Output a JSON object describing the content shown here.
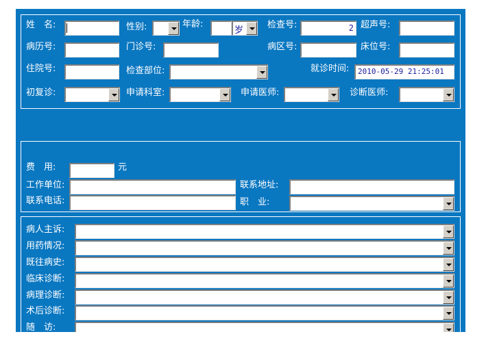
{
  "top": {
    "name_label": "姓　名:",
    "gender_label": "性别:",
    "age_label": "年龄:",
    "age_unit": "岁",
    "exam_no_label": "检查号:",
    "exam_no_value": "2",
    "ultrasound_no_label": "超声号:",
    "record_no_label": "病历号:",
    "clinic_no_label": "门诊号:",
    "ward_label": "病区号:",
    "bed_label": "床位号:",
    "inpatient_no_label": "住院号:",
    "exam_site_label": "检查部位:",
    "visit_time_label": "就诊时间:",
    "visit_time_value": "2010-05-29 21:25:01",
    "first_visit_label": "初复诊:",
    "dept_label": "申请科室:",
    "req_doctor_label": "申请医师:",
    "diag_doctor_label": "诊断医师:"
  },
  "middle": {
    "fee_label": "费　用:",
    "fee_unit": "元",
    "employer_label": "工作单位:",
    "address_label": "联系地址:",
    "phone_label": "联系电话:",
    "occupation_label": "职　业:"
  },
  "clinical": [
    {
      "label": "病人主诉:"
    },
    {
      "label": "用药情况:"
    },
    {
      "label": "既往病史:"
    },
    {
      "label": "临床诊断:"
    },
    {
      "label": "病理诊断:"
    },
    {
      "label": "术后诊断:"
    },
    {
      "label": "随　访:"
    }
  ]
}
